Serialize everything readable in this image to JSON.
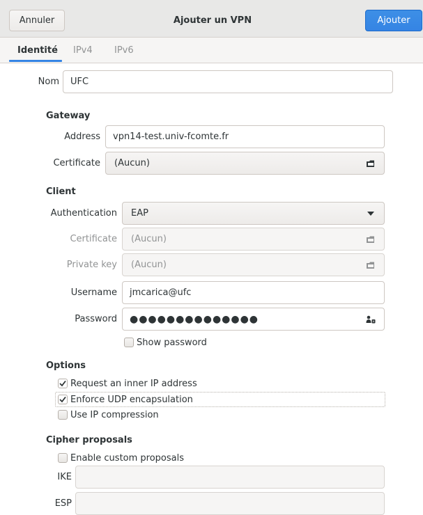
{
  "dialog": {
    "title": "Ajouter un VPN",
    "cancel_label": "Annuler",
    "add_label": "Ajouter"
  },
  "tabs": [
    {
      "label": "Identité",
      "active": true
    },
    {
      "label": "IPv4",
      "active": false
    },
    {
      "label": "IPv6",
      "active": false
    }
  ],
  "identity": {
    "name_label": "Nom",
    "name_value": "UFC"
  },
  "gateway": {
    "heading": "Gateway",
    "address_label": "Address",
    "address_value": "vpn14-test.univ-fcomte.fr",
    "certificate_label": "Certificate",
    "certificate_value": "(Aucun)"
  },
  "client": {
    "heading": "Client",
    "auth_label": "Authentication",
    "auth_value": "EAP",
    "certificate_label": "Certificate",
    "certificate_value": "(Aucun)",
    "private_key_label": "Private key",
    "private_key_value": "(Aucun)",
    "username_label": "Username",
    "username_value": "jmcarica@ufc",
    "password_label": "Password",
    "password_value": "●●●●●●●●●●●●●●",
    "show_password_label": "Show password",
    "show_password_checked": false
  },
  "options": {
    "heading": "Options",
    "request_inner_ip_label": "Request an inner IP address",
    "request_inner_ip_checked": true,
    "enforce_udp_label": "Enforce UDP encapsulation",
    "enforce_udp_checked": true,
    "ip_compression_label": "Use IP compression",
    "ip_compression_checked": false
  },
  "cipher": {
    "heading": "Cipher proposals",
    "enable_custom_label": "Enable custom proposals",
    "enable_custom_checked": false,
    "ike_label": "IKE",
    "ike_value": "",
    "esp_label": "ESP",
    "esp_value": ""
  },
  "colors": {
    "accent": "#3584e4",
    "header_bg": "#e8e8e7",
    "dim_text": "#919394"
  },
  "icons": {
    "file_chooser": "document-open-icon",
    "dropdown": "chevron-down-icon",
    "password_storage": "user-key-icon",
    "checkmark": "check-icon"
  }
}
